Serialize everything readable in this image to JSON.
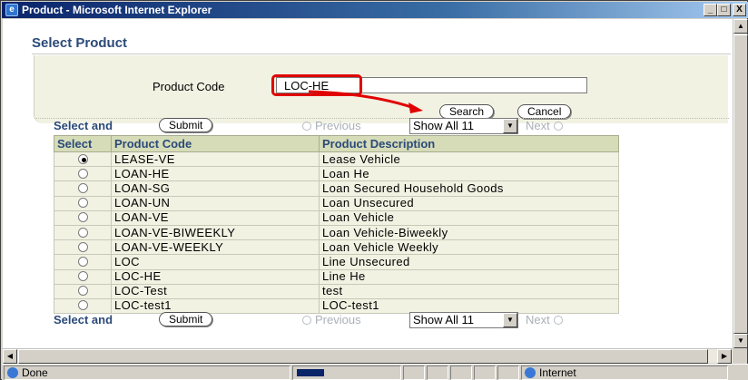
{
  "window": {
    "title": "Product - Microsoft Internet Explorer",
    "min_label": "_",
    "max_label": "□",
    "close_label": "X"
  },
  "page": {
    "title": "Select Product"
  },
  "search": {
    "product_code_label": "Product Code",
    "product_code_value": "LOC-HE",
    "search_label": "Search",
    "cancel_label": "Cancel"
  },
  "nav": {
    "select_and_label": "Select and",
    "submit_label": "Submit",
    "previous_label": "Previous",
    "show_all_value": "Show All 11",
    "next_label": "Next"
  },
  "table": {
    "columns": [
      "Select",
      "Product Code",
      "Product Description"
    ],
    "selected_index": 0,
    "rows": [
      {
        "code": "LEASE-VE",
        "description": "Lease Vehicle"
      },
      {
        "code": "LOAN-HE",
        "description": "Loan He"
      },
      {
        "code": "LOAN-SG",
        "description": "Loan Secured Household Goods"
      },
      {
        "code": "LOAN-UN",
        "description": "Loan Unsecured"
      },
      {
        "code": "LOAN-VE",
        "description": "Loan Vehicle"
      },
      {
        "code": "LOAN-VE-BIWEEKLY",
        "description": "Loan Vehicle-Biweekly"
      },
      {
        "code": "LOAN-VE-WEEKLY",
        "description": "Loan Vehicle Weekly"
      },
      {
        "code": "LOC",
        "description": "Line Unsecured"
      },
      {
        "code": "LOC-HE",
        "description": "Line He"
      },
      {
        "code": "LOC-Test",
        "description": "test"
      },
      {
        "code": "LOC-test1",
        "description": "LOC-test1"
      }
    ]
  },
  "statusbar": {
    "status_text": "Done",
    "zone_text": "Internet"
  },
  "colors": {
    "accent": "#2b4a78",
    "highlight": "#e00000",
    "header_bg": "#d6dcb8",
    "row_bg": "#f2f2e3"
  }
}
